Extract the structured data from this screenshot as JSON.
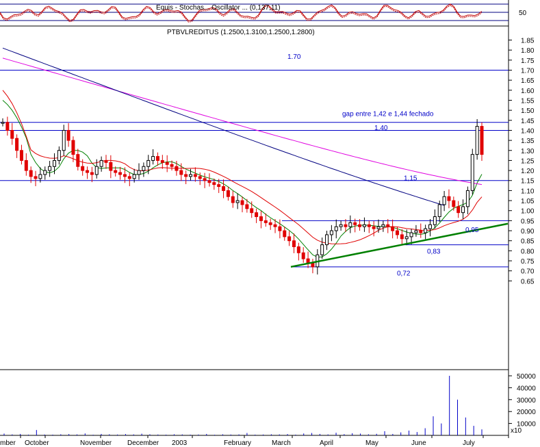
{
  "header": {
    "indicator_text": "Equis - Stochastic Oscillator (5,3,3) / Stochastic Oscillator (14,3,3)",
    "indicator_overlap": "Equis - Stochas... Oscillator ... (0,137,11)",
    "osc_axis_label": "50",
    "price_title": "PTBVLREDITUS (1.2500,1.3100,1.2500,1.2800)",
    "volume_unit": "x10"
  },
  "colors": {
    "horizontal_lines": "#0000c8",
    "annotations": "#0000c8",
    "trend_line": "#008000",
    "ma_short": "#008000",
    "ma_mid": "#e00000",
    "ma_long_pink": "#e000e0",
    "ma_long_navy": "#000080",
    "candle_up": "#000000",
    "candle_down": "#e00000",
    "volume": "#0000c8",
    "oscillator": "#c00000"
  },
  "chart_data": {
    "type": "candlestick",
    "title": "PTBVLREDITUS (1.2500,1.3100,1.2500,1.2800)",
    "x_tick_labels": [
      "mber",
      "October",
      "November",
      "December",
      "2003",
      "February",
      "March",
      "April",
      "May",
      "June",
      "July"
    ],
    "y_price_ticks": [
      "1.85",
      "1.80",
      "1.75",
      "1.70",
      "1.65",
      "1.60",
      "1.55",
      "1.50",
      "1.45",
      "1.40",
      "1.35",
      "1.30",
      "1.25",
      "1.20",
      "1.15",
      "1.10",
      "1.05",
      "1.00",
      "0.95",
      "0.90",
      "0.85",
      "0.80",
      "0.75",
      "0.70",
      "0.65"
    ],
    "y_volume_ticks": [
      "50000",
      "40000",
      "30000",
      "20000",
      "10000"
    ],
    "price_range": [
      0.6,
      1.9
    ],
    "volume_range": [
      0,
      55000
    ],
    "horizontal_levels": [
      1.7,
      1.44,
      1.4,
      1.15,
      0.95,
      0.83,
      0.72
    ],
    "annotations": [
      {
        "text": "1.70",
        "price": 1.77
      },
      {
        "text": "gap entre 1,42 e 1,44 fechado",
        "price": 1.485
      },
      {
        "text": "1,40",
        "price": 1.415
      },
      {
        "text": "1,15",
        "price": 1.165
      },
      {
        "text": "0,95",
        "price": 0.907
      },
      {
        "text": "0,83",
        "price": 0.8
      },
      {
        "text": "0,72",
        "price": 0.69
      }
    ],
    "trend_line": {
      "from_price": 0.72,
      "to_price": 0.935
    },
    "price_series_close": [
      1.44,
      1.4,
      1.36,
      1.3,
      1.25,
      1.2,
      1.17,
      1.16,
      1.18,
      1.2,
      1.22,
      1.25,
      1.3,
      1.4,
      1.35,
      1.28,
      1.22,
      1.2,
      1.19,
      1.18,
      1.22,
      1.25,
      1.24,
      1.2,
      1.19,
      1.18,
      1.17,
      1.16,
      1.18,
      1.2,
      1.22,
      1.25,
      1.27,
      1.25,
      1.24,
      1.23,
      1.22,
      1.2,
      1.18,
      1.17,
      1.18,
      1.17,
      1.16,
      1.15,
      1.14,
      1.13,
      1.12,
      1.1,
      1.07,
      1.04,
      1.05,
      1.03,
      1.01,
      0.99,
      0.97,
      0.95,
      0.94,
      0.93,
      0.92,
      0.9,
      0.87,
      0.85,
      0.82,
      0.79,
      0.76,
      0.74,
      0.72,
      0.78,
      0.83,
      0.88,
      0.9,
      0.92,
      0.93,
      0.92,
      0.94,
      0.93,
      0.92,
      0.93,
      0.92,
      0.91,
      0.92,
      0.93,
      0.92,
      0.9,
      0.88,
      0.86,
      0.87,
      0.89,
      0.9,
      0.89,
      0.91,
      0.93,
      0.97,
      1.03,
      1.07,
      1.05,
      1.02,
      0.99,
      1.02,
      1.1,
      1.28,
      1.42,
      1.28
    ],
    "volume_series": [
      1500,
      800,
      1200,
      600,
      4500,
      700,
      600,
      900,
      1100,
      800,
      1600,
      500,
      1200,
      900,
      700,
      1100,
      800,
      1400,
      900,
      700,
      600,
      900,
      800,
      600,
      700,
      1200,
      500,
      900,
      700,
      800,
      2000,
      600,
      700,
      900,
      800,
      1100,
      600,
      1600,
      2000,
      1200,
      800,
      2200,
      1000,
      1800,
      1500,
      900,
      1300,
      3500,
      1200,
      2500,
      4000,
      2800,
      6000,
      16000,
      10000,
      50000,
      30000,
      15000,
      8000,
      5000
    ]
  }
}
